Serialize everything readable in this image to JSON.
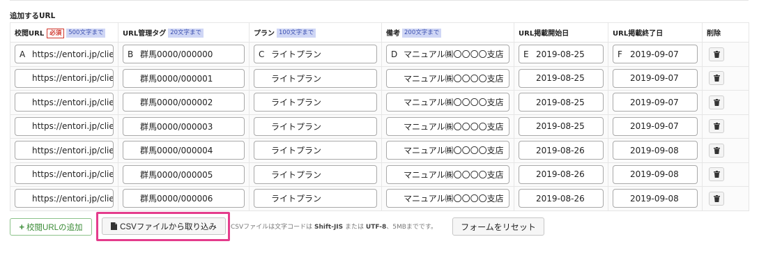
{
  "section_title": "追加するURL",
  "table": {
    "headers": {
      "url": "校閲URL",
      "required": "必須",
      "url_limit": "500文字まで",
      "tag": "URL管理タグ",
      "tag_limit": "20文字まで",
      "plan": "プラン",
      "plan_limit": "100文字まで",
      "note": "備考",
      "note_limit": "200文字まで",
      "start": "URL掲載開始日",
      "end": "URL掲載終了日",
      "delete": "削除"
    },
    "prefixes": [
      "A",
      "B",
      "C",
      "D",
      "E",
      "F"
    ],
    "rows": [
      {
        "url": "https://entori.jp/client",
        "tag": "群馬0000/000000",
        "plan": "ライトプラン",
        "note": "マニュアル㈱〇〇〇〇支店",
        "start": "2019-08-25",
        "end": "2019-09-07"
      },
      {
        "url": "https://entori.jp/client",
        "tag": "群馬0000/000001",
        "plan": "ライトプラン",
        "note": "マニュアル㈱〇〇〇〇支店",
        "start": "2019-08-25",
        "end": "2019-09-07"
      },
      {
        "url": "https://entori.jp/client",
        "tag": "群馬0000/000002",
        "plan": "ライトプラン",
        "note": "マニュアル㈱〇〇〇〇支店",
        "start": "2019-08-25",
        "end": "2019-09-07"
      },
      {
        "url": "https://entori.jp/client",
        "tag": "群馬0000/000003",
        "plan": "ライトプラン",
        "note": "マニュアル㈱〇〇〇〇支店",
        "start": "2019-08-25",
        "end": "2019-09-07"
      },
      {
        "url": "https://entori.jp/client",
        "tag": "群馬0000/000004",
        "plan": "ライトプラン",
        "note": "マニュアル㈱〇〇〇〇支店",
        "start": "2019-08-26",
        "end": "2019-09-08"
      },
      {
        "url": "https://entori.jp/client",
        "tag": "群馬0000/000005",
        "plan": "ライトプラン",
        "note": "マニュアル㈱〇〇〇〇支店",
        "start": "2019-08-26",
        "end": "2019-09-08"
      },
      {
        "url": "https://entori.jp/client",
        "tag": "群馬0000/000006",
        "plan": "ライトプラン",
        "note": "マニュアル㈱〇〇〇〇支店",
        "start": "2019-08-26",
        "end": "2019-09-08"
      }
    ]
  },
  "footer": {
    "add_button": "校閲URLの追加",
    "csv_button": "CSVファイルから取り込み",
    "csv_note_1": "CSVファイルは文字コードは",
    "csv_note_enc1": "Shift-JIS",
    "csv_note_2": "または",
    "csv_note_enc2": "UTF-8",
    "csv_note_3": "、5MBまでです。",
    "reset_button": "フォームをリセット"
  },
  "colors": {
    "highlight": "#e43c8c",
    "add_green": "#3b8c37",
    "required_red": "#d0352b",
    "limit_badge": "#cfd6f5"
  }
}
